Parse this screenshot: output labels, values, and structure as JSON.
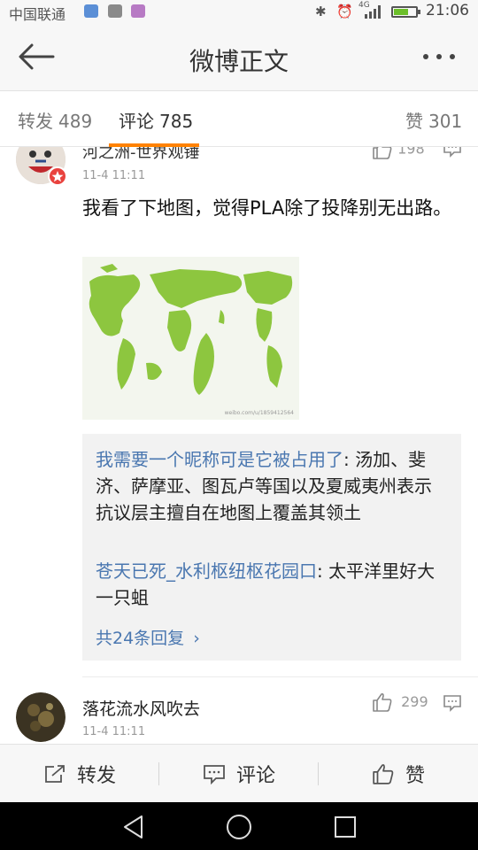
{
  "status_bar": {
    "carrier": "中国联通",
    "network": "4G",
    "time": "21:06"
  },
  "header": {
    "title": "微博正文",
    "back_icon": "back-arrow-icon",
    "more_icon": "more-dots-icon"
  },
  "tabs": {
    "repost_label": "转发",
    "repost_count": "489",
    "comment_label": "评论",
    "comment_count": "785",
    "like_label": "赞",
    "like_count": "301",
    "accent_color": "#ff8200"
  },
  "comments": [
    {
      "username": "河之洲-世界观锤",
      "time": "11-4 11:11",
      "like_count": "198",
      "text": "我看了下地图，觉得PLA除了投降别无出路。",
      "image_watermark": "weibo.com/u/1859412564",
      "replies": [
        {
          "user": "我需要一个昵称可是它被占用了",
          "sep": ": ",
          "text": "汤加、斐济、萨摩亚、图瓦卢等国以及夏威夷州表示抗议层主擅自在地图上覆盖其领土"
        },
        {
          "user": "苍天已死_水利枢纽枢花园口",
          "sep": ": ",
          "text": "太平洋里好大一只蛆"
        }
      ],
      "more_replies": "共24条回复"
    },
    {
      "username": "落花流水风吹去",
      "time": "11-4 11:11",
      "like_count": "299"
    }
  ],
  "action_bar": {
    "repost": "转发",
    "comment": "评论",
    "like": "赞"
  },
  "colors": {
    "link_blue": "#4a77b0",
    "map_green": "#8dc63f"
  }
}
